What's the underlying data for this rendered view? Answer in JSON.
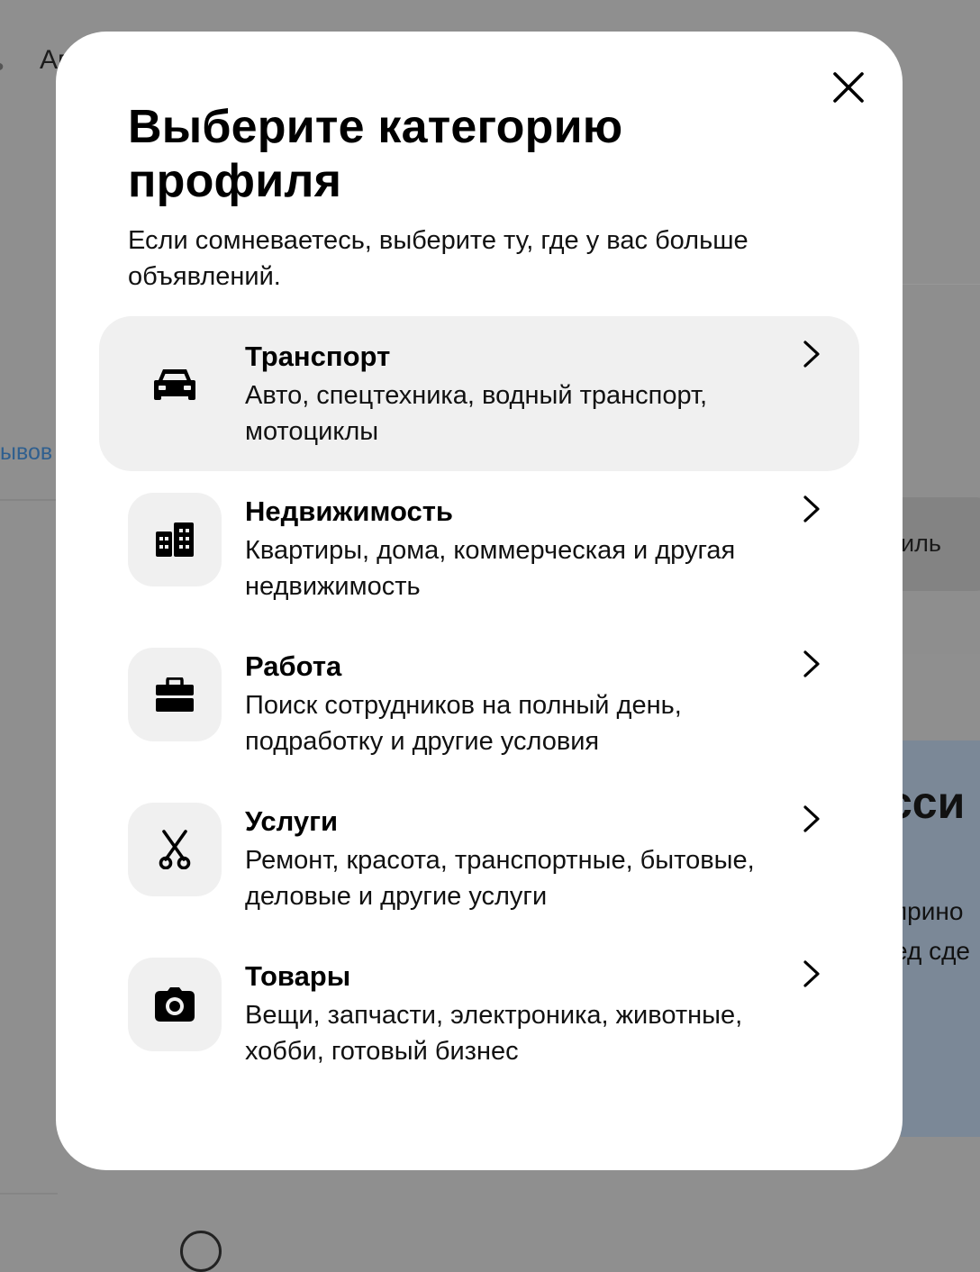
{
  "background": {
    "breadcrumb_dot": "•",
    "breadcrumb_text": "Ав",
    "link_text": "ывов",
    "pill_text": "иль",
    "banner_title": "сси",
    "banner_line1": "прино",
    "banner_line2": "ед сде"
  },
  "modal": {
    "title": "Выберите категорию профиля",
    "subtitle": "Если сомневаетесь, выберите ту, где у вас больше объявлений.",
    "close_icon": "close-icon",
    "categories": [
      {
        "title": "Транспорт",
        "description": "Авто, спецтехника, водный транспорт, мотоциклы",
        "icon": "car-icon",
        "highlighted": true
      },
      {
        "title": "Недвижимость",
        "description": "Квартиры, дома, коммерческая и другая недвижимость",
        "icon": "building-icon",
        "highlighted": false
      },
      {
        "title": "Работа",
        "description": "Поиск сотрудников на полный день, подработку и другие условия",
        "icon": "briefcase-icon",
        "highlighted": false
      },
      {
        "title": "Услуги",
        "description": "Ремонт, красота, транспортные, бытовые, деловые и другие услуги",
        "icon": "scissors-icon",
        "highlighted": false
      },
      {
        "title": "Товары",
        "description": "Вещи, запчасти, электроника, животные, хобби, готовый бизнес",
        "icon": "camera-icon",
        "highlighted": false
      }
    ]
  },
  "colors": {
    "overlay": "#8f8f8f",
    "modal_bg": "#ffffff",
    "highlight_bg": "#f0f0f0",
    "text": "#000000"
  }
}
